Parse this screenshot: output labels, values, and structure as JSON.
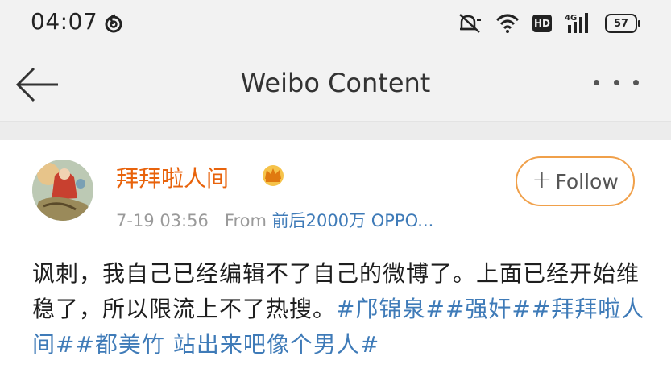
{
  "status_bar": {
    "time": "04:07",
    "app_icon": "netease-music-icon",
    "network_label": "4G",
    "hd_label": "HD",
    "battery": "57"
  },
  "nav": {
    "title": "Weibo Content",
    "back_icon": "arrow-left-icon",
    "more_icon": "more-dots-icon"
  },
  "post": {
    "user_name": "拜拜啦人间",
    "badge_icon": "crown-vip-icon",
    "time": "7-19 03:56",
    "from_label": "From",
    "source": "前后2000万 OPPO...",
    "follow_label": "Follow",
    "text": "讽刺，我自己已经编辑不了自己的微博了。上面已经开始维稳了，所以限流上不了热搜。",
    "topics": [
      "#邝锦泉#",
      "#强奸#",
      "#拜拜啦人间#",
      "#都美竹 站出来吧像个男人#"
    ]
  },
  "colors": {
    "username": "#e8630c",
    "link": "#3f7bb8",
    "follow_border": "#f0a04a"
  }
}
